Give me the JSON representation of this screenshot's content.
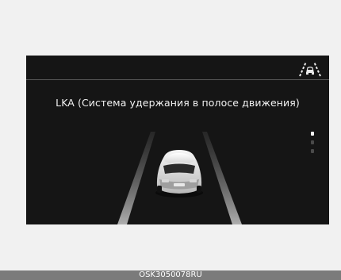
{
  "display": {
    "title": "LKA (Система удержания в полосе движения)",
    "status_icon": "lane-keeping-car-icon",
    "illustration": "car-between-lane-lines",
    "page_indicator": {
      "count": 3,
      "active_index": 0
    }
  },
  "footer": {
    "code": "OSK3050078RU"
  },
  "colors": {
    "screen_background": "#151515",
    "page_background": "#f1f1f1",
    "footer_background": "#7b7b7b"
  }
}
